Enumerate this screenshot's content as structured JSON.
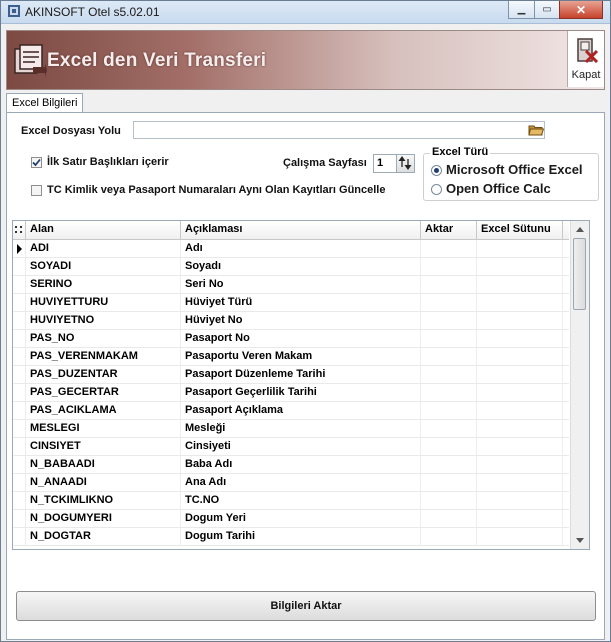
{
  "window": {
    "title": "AKINSOFT Otel s5.02.01"
  },
  "banner": {
    "title": "Excel den Veri Transferi",
    "close_label": "Kapat"
  },
  "tabs": [
    {
      "label": "Excel Bilgileri"
    }
  ],
  "form": {
    "file_label": "Excel Dosyası Yolu",
    "file_value": "",
    "first_row_headers_label": "İlk Satır Başlıkları içerir",
    "first_row_headers_checked": true,
    "update_label": "TC Kimlik veya Pasaport Numaraları Aynı Olan Kayıtları Güncelle",
    "update_checked": false,
    "sheet_label": "Çalışma Sayfası",
    "sheet_value": "1"
  },
  "excel_type": {
    "title": "Excel Türü",
    "options": [
      {
        "label": "Microsoft Office Excel",
        "selected": true
      },
      {
        "label": "Open Office Calc",
        "selected": false
      }
    ]
  },
  "grid": {
    "columns": [
      "Alan",
      "Açıklaması",
      "Aktar",
      "Excel Sütunu"
    ],
    "rows": [
      [
        "ADI",
        "Adı",
        "",
        ""
      ],
      [
        "SOYADI",
        "Soyadı",
        "",
        ""
      ],
      [
        "SERINO",
        "Seri No",
        "",
        ""
      ],
      [
        "HUVIYETTURU",
        "Hüviyet Türü",
        "",
        ""
      ],
      [
        "HUVIYETNO",
        "Hüviyet No",
        "",
        ""
      ],
      [
        "PAS_NO",
        "Pasaport No",
        "",
        ""
      ],
      [
        "PAS_VERENMAKAM",
        "Pasaportu Veren Makam",
        "",
        ""
      ],
      [
        "PAS_DUZENTAR",
        "Pasaport Düzenleme Tarihi",
        "",
        ""
      ],
      [
        "PAS_GECERTAR",
        "Pasaport Geçerlilik Tarihi",
        "",
        ""
      ],
      [
        "PAS_ACIKLAMA",
        "Pasaport Açıklama",
        "",
        ""
      ],
      [
        "MESLEGI",
        "Mesleği",
        "",
        ""
      ],
      [
        "CINSIYET",
        "Cinsiyeti",
        "",
        ""
      ],
      [
        "N_BABAADI",
        "Baba Adı",
        "",
        ""
      ],
      [
        "N_ANAADI",
        "Ana Adı",
        "",
        ""
      ],
      [
        "N_TCKIMLIKNO",
        "TC.NO",
        "",
        ""
      ],
      [
        "N_DOGUMYERI",
        "Dogum Yeri",
        "",
        ""
      ],
      [
        "N_DOGTAR",
        "Dogum Tarihi",
        "",
        ""
      ]
    ]
  },
  "actions": {
    "transfer_label": "Bilgileri Aktar"
  }
}
